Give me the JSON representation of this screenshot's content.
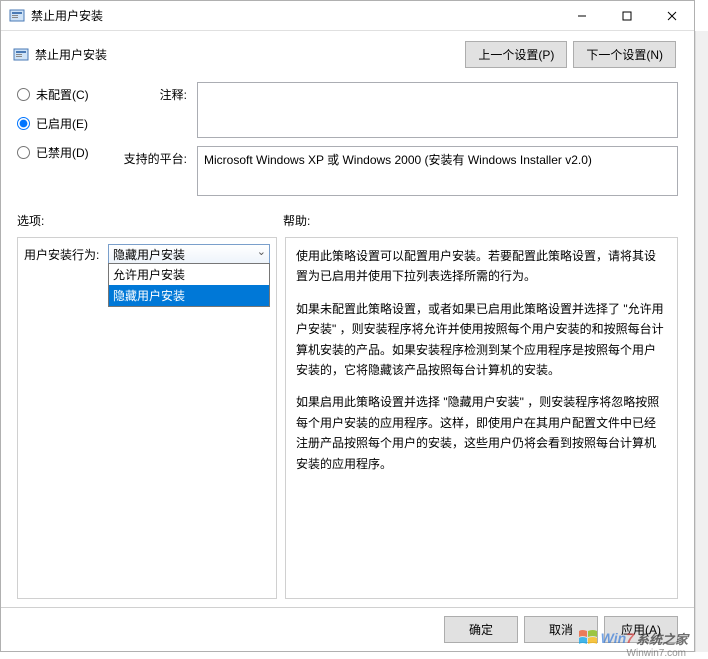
{
  "window": {
    "title": "禁止用户安装"
  },
  "header": {
    "title": "禁止用户安装",
    "prev_btn": "上一个设置(P)",
    "next_btn": "下一个设置(N)"
  },
  "radios": {
    "not_configured": "未配置(C)",
    "enabled": "已启用(E)",
    "disabled": "已禁用(D)",
    "selected": "enabled"
  },
  "fields": {
    "comment_label": "注释:",
    "comment_value": "",
    "platform_label": "支持的平台:",
    "platform_value": "Microsoft Windows XP 或 Windows 2000 (安装有 Windows Installer v2.0)"
  },
  "sections": {
    "options_label": "选项:",
    "help_label": "帮助:"
  },
  "options": {
    "behavior_label": "用户安装行为:",
    "behavior_selected": "隐藏用户安装",
    "behavior_choices": [
      "允许用户安装",
      "隐藏用户安装"
    ]
  },
  "help": {
    "p1": "使用此策略设置可以配置用户安装。若要配置此策略设置，请将其设置为已启用并使用下拉列表选择所需的行为。",
    "p2": "如果未配置此策略设置，或者如果已启用此策略设置并选择了 \"允许用户安装\" ，则安装程序将允许并使用按照每个用户安装的和按照每台计算机安装的产品。如果安装程序检测到某个应用程序是按照每个用户安装的，它将隐藏该产品按照每台计算机的安装。",
    "p3": "如果启用此策略设置并选择 \"隐藏用户安装\" ，则安装程序将忽略按照每个用户安装的应用程序。这样，即使用户在其用户配置文件中已经注册产品按照每个用户的安装，这些用户仍将会看到按照每台计算机安装的应用程序。"
  },
  "footer": {
    "ok": "确定",
    "cancel": "取消",
    "apply": "应用(A)"
  },
  "watermark": {
    "brand1": "Win",
    "brand2": "7",
    "brand3": "系统之家",
    "url": "Winwin7.com"
  }
}
